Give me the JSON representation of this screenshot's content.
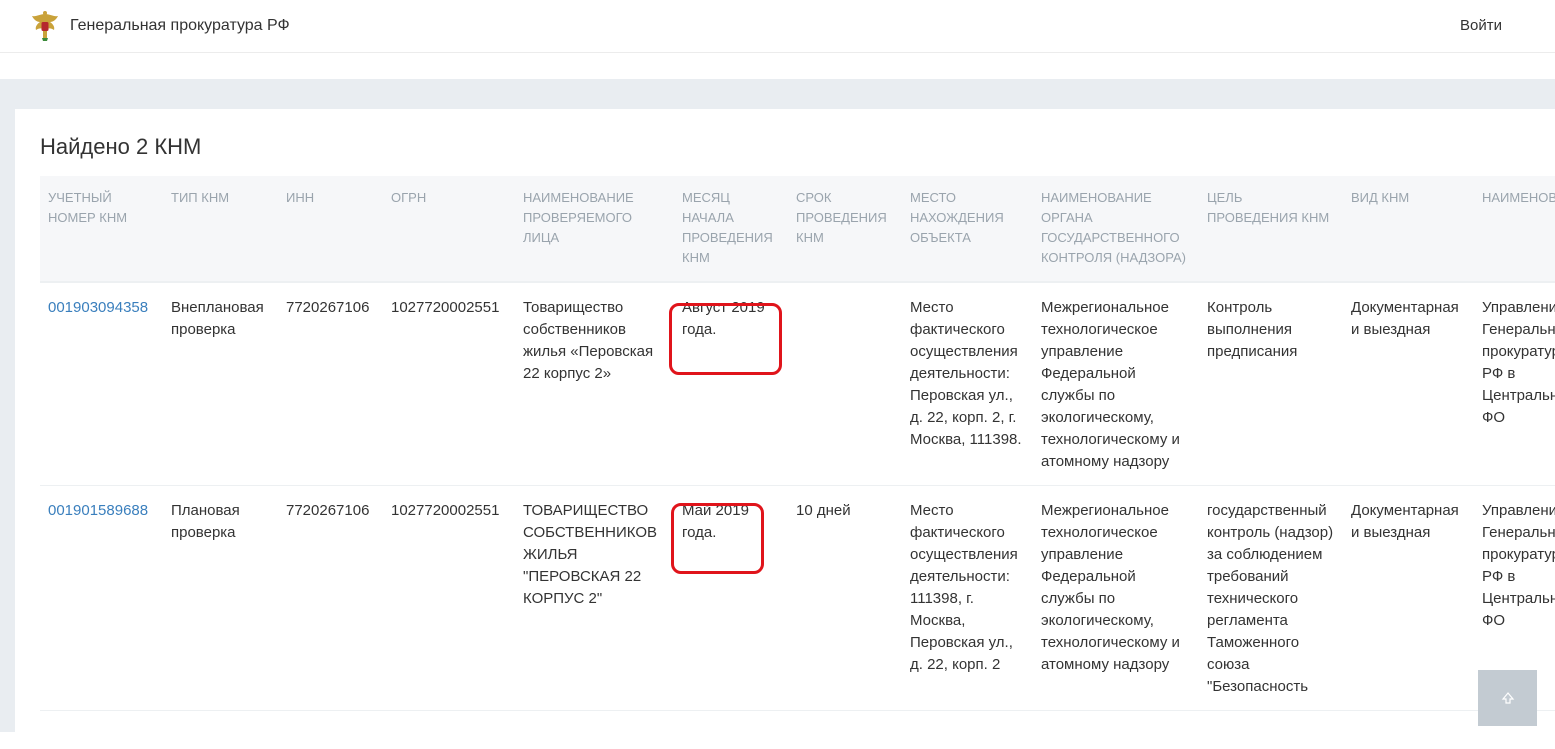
{
  "header": {
    "title": "Генеральная прокуратура РФ",
    "login_label": "Войти",
    "emblem_icon": "emblem-eagle-icon"
  },
  "results": {
    "found_label": "Найдено 2 КНМ",
    "columns": [
      "Учетный номер КНМ",
      "Тип КНМ",
      "ИНН",
      "ОГРН",
      "Наименование проверяемого лица",
      "Месяц начала проведения КНМ",
      "Срок проведения КНМ",
      "Место нахождения объекта",
      "Наименование органа государственного контроля (надзора)",
      "Цель проведения КНМ",
      "Вид КНМ",
      "Наименование органа прокуратуры"
    ],
    "rows": [
      {
        "number": "001903094358",
        "type": "Внеплановая проверка",
        "inn": "7720267106",
        "ogrn": "1027720002551",
        "name": "Товарищество собственников жилья «Перовская 22 корпус 2»",
        "month": "Август 2019 года.",
        "duration": "",
        "location": "Место фактического осуществления деятельности: Перовская ул., д. 22, корп. 2, г. Москва, 111398.",
        "authority": "Межрегиональное технологическое управление Федеральной службы по экологическому, технологическому и атомному надзору",
        "goal": "Контроль выполнения предписания",
        "kind": "Документарная и выездная",
        "prosecutor": "Управление Генеральной прокуратуры РФ в Центральном ФО"
      },
      {
        "number": "001901589688",
        "type": "Плановая проверка",
        "inn": "7720267106",
        "ogrn": "1027720002551",
        "name": "ТОВАРИЩЕСТВО СОБСТВЕННИКОВ ЖИЛЬЯ \"ПЕРОВСКАЯ 22 КОРПУС 2\"",
        "month": "Май 2019 года.",
        "duration": "10 дней",
        "location": "Место фактического осуществления деятельности: 111398, г. Москва, Перовская ул., д. 22, корп. 2",
        "authority": "Межрегиональное технологическое управление Федеральной службы по экологическому, технологическому и атомному надзору",
        "goal": "государственный контроль (надзор) за соблюдением требований технического регламента Таможенного союза \"Безопасность",
        "kind": "Документарная и выездная",
        "prosecutor": "Управление Генеральной прокуратуры РФ в Центральном ФО"
      }
    ]
  },
  "scroll_top_icon": "arrow-up-icon",
  "colors": {
    "link": "#3a7fbd",
    "highlight": "#e0141b",
    "band": "#e9edf1"
  }
}
